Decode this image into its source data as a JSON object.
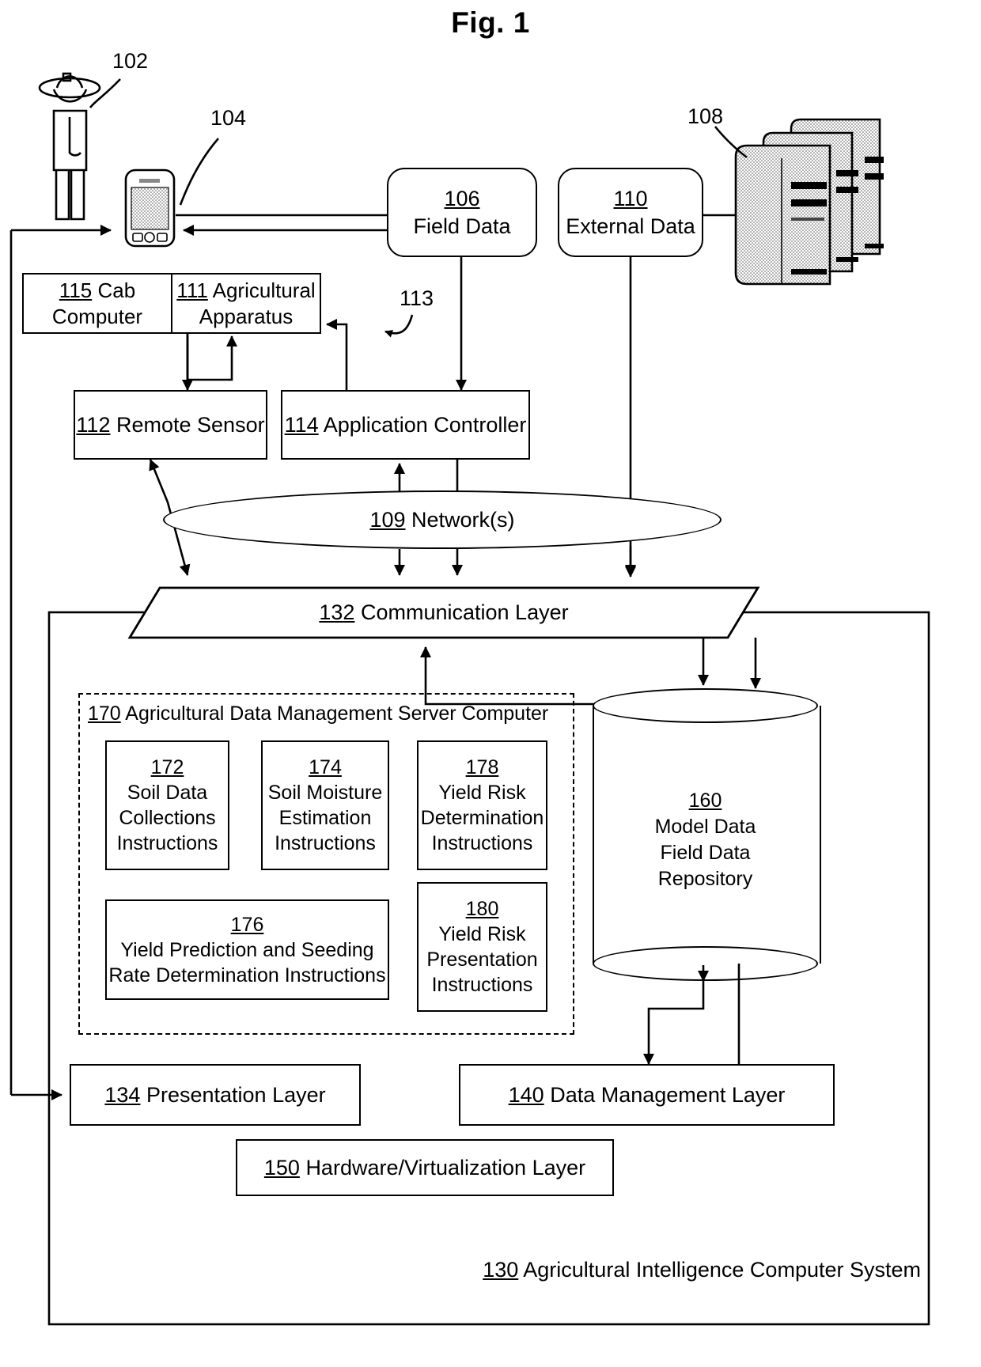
{
  "figure": {
    "title": "Fig. 1"
  },
  "labels": {
    "user_ref": "102",
    "phone_ref": "104",
    "servers_ref": "108",
    "link_113_ref": "113"
  },
  "nodes": {
    "field_data": {
      "ref": "106",
      "label": "Field Data"
    },
    "external_data": {
      "ref": "110",
      "label": "External Data"
    },
    "cab_computer": {
      "ref": "115",
      "label": "Cab",
      "label2": "Computer"
    },
    "agricultural_apparatus": {
      "ref": "111",
      "label": "Agricultural",
      "label2": "Apparatus"
    },
    "remote_sensor": {
      "ref": "112",
      "label": "Remote Sensor"
    },
    "application_controller": {
      "ref": "114",
      "label": "Application Controller"
    },
    "network": {
      "ref": "109",
      "label": "Network(s)"
    },
    "communication_layer": {
      "ref": "132",
      "label": "Communication Layer"
    },
    "server_computer": {
      "ref": "170",
      "label": "Agricultural Data Management Server Computer"
    },
    "soil_data_collections": {
      "ref": "172",
      "line1": "Soil Data",
      "line2": "Collections",
      "line3": "Instructions"
    },
    "soil_moisture_estimation": {
      "ref": "174",
      "line1": "Soil Moisture",
      "line2": "Estimation",
      "line3": "Instructions"
    },
    "yield_risk_determination": {
      "ref": "178",
      "line1": "Yield Risk",
      "line2": "Determination",
      "line3": "Instructions"
    },
    "yield_prediction_seeding": {
      "ref": "176",
      "line1": "Yield Prediction and Seeding",
      "line2": "Rate Determination Instructions"
    },
    "yield_risk_presentation": {
      "ref": "180",
      "line1": "Yield Risk",
      "line2": "Presentation",
      "line3": "Instructions"
    },
    "repository": {
      "ref": "160",
      "line1": "Model Data",
      "line2": "Field Data",
      "line3": "Repository"
    },
    "presentation_layer": {
      "ref": "134",
      "label": "Presentation Layer"
    },
    "data_management_layer": {
      "ref": "140",
      "label": "Data Management Layer"
    },
    "hardware_virtualization_layer": {
      "ref": "150",
      "label": "Hardware/Virtualization Layer"
    },
    "system": {
      "ref": "130",
      "label": "Agricultural Intelligence Computer System"
    }
  },
  "icons": {
    "user": "person-icon",
    "phone": "mobile-phone-icon",
    "servers": "server-stack-icon",
    "database": "database-cylinder-icon"
  },
  "colors": {
    "stroke": "#000000",
    "background": "#ffffff",
    "server_fill": "#d9d9d9"
  }
}
